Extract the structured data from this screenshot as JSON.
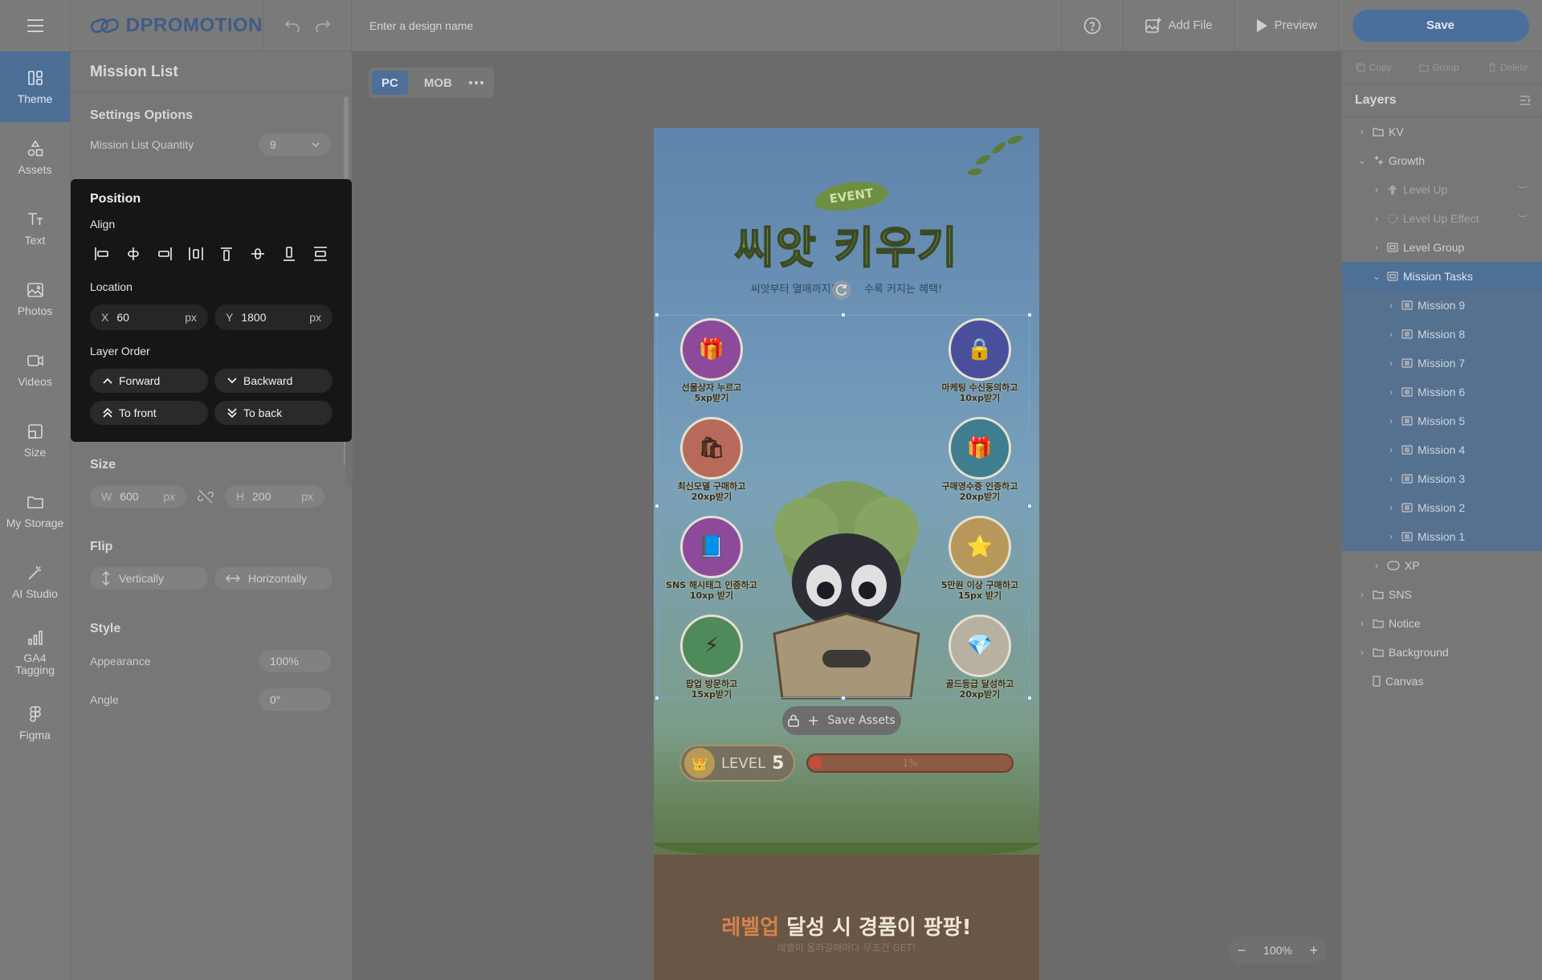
{
  "app": {
    "brand": "DPROMOTION"
  },
  "topbar": {
    "design_name_placeholder": "Enter a design name",
    "add_file_label": "Add File",
    "preview_label": "Preview",
    "save_label": "Save"
  },
  "rail": {
    "items": [
      {
        "label": "Theme",
        "icon": "theme-icon"
      },
      {
        "label": "Assets",
        "icon": "assets-icon"
      },
      {
        "label": "Text",
        "icon": "text-icon"
      },
      {
        "label": "Photos",
        "icon": "photos-icon"
      },
      {
        "label": "Videos",
        "icon": "videos-icon"
      },
      {
        "label": "Size",
        "icon": "size-icon"
      },
      {
        "label": "My Storage",
        "icon": "folder-icon"
      },
      {
        "label": "AI Studio",
        "icon": "magic-wand-icon"
      },
      {
        "label": "GA4 Tagging",
        "icon": "bar-chart-icon"
      },
      {
        "label": "Figma",
        "icon": "figma-icon"
      }
    ]
  },
  "panel": {
    "title": "Mission List",
    "settings_options_label": "Settings Options",
    "mission_list_quantity_label": "Mission List Quantity",
    "mission_list_quantity_value": "9",
    "size_label": "Size",
    "width_axis": "W",
    "width_value": "600",
    "height_axis": "H",
    "height_value": "200",
    "unit": "px",
    "flip_label": "Flip",
    "flip_vertical": "Vertically",
    "flip_horizontal": "Horizontally",
    "style_label": "Style",
    "appearance_label": "Appearance",
    "appearance_value": "100%",
    "angle_label": "Angle",
    "angle_value": "0°"
  },
  "position_popup": {
    "title": "Position",
    "align_label": "Align",
    "location_label": "Location",
    "x_axis": "X",
    "x_value": "60",
    "y_axis": "Y",
    "y_value": "1800",
    "unit": "px",
    "layer_order_label": "Layer Order",
    "forward": "Forward",
    "backward": "Backward",
    "to_front": "To front",
    "to_back": "To back"
  },
  "canvas": {
    "device_pc": "PC",
    "device_mob": "MOB",
    "zoom_value": "100%",
    "save_assets_label": "Save Assets"
  },
  "artboard": {
    "event_tag": "EVENT",
    "title": "씨앗 키우기",
    "subtitle_left": "씨앗부터 열매까지!",
    "subtitle_right": "수록 커지는 혜택!",
    "missions": [
      {
        "line1": "선물상자 누르고",
        "line2": "5xp받기",
        "color": "#8d4a9a",
        "icon": "🎁"
      },
      {
        "line1": "마케팅 수신동의하고",
        "line2": "10xp받기",
        "color": "#4a4f9c",
        "icon": "🔒"
      },
      {
        "line1": "최신모델 구매하고",
        "line2": "20xp받기",
        "color": "#b86a5a",
        "icon": "🛍"
      },
      {
        "line1": "구매영수증 인증하고",
        "line2": "20xp받기",
        "color": "#3f7e8e",
        "icon": "🎁"
      },
      {
        "line1": "SNS 해시태그 인증하고",
        "line2": "10xp 받기",
        "color": "#8d4a9a",
        "icon": "📘"
      },
      {
        "line1": "5만원 이상 구매하고",
        "line2": "15px 받기",
        "color": "#b8985a",
        "icon": "⭐"
      },
      {
        "line1": "팝업 방문하고",
        "line2": "15xp받기",
        "color": "#4f8a5a",
        "icon": "⚡"
      },
      {
        "line1": "골드등급 달성하고",
        "line2": "20xp받기",
        "color": "#b8b0a0",
        "icon": "💎"
      }
    ],
    "level_prefix": "LEVEL",
    "level_number": "5",
    "progress_percent": 1,
    "progress_label": "1%",
    "reward_highlight": "레벨업",
    "reward_rest": " 달성 시 경품이 팡팡!",
    "reward_sub": "레벨이 올라갈때마다 무조건 GET!"
  },
  "right_panel": {
    "copy": "Copy",
    "group": "Group",
    "delete": "Delete",
    "layers_title": "Layers",
    "layers": [
      {
        "label": "KV",
        "indent": 0,
        "state": "normal",
        "chev": "›",
        "icon": "folder"
      },
      {
        "label": "Growth",
        "indent": 0,
        "state": "normal",
        "chev": "⌄",
        "icon": "sparkle"
      },
      {
        "label": "Level Up",
        "indent": 1,
        "state": "dim",
        "chev": "›",
        "icon": "arrow-up"
      },
      {
        "label": "Level Up Effect",
        "indent": 1,
        "state": "dim",
        "chev": "›",
        "icon": "dashed"
      },
      {
        "label": "Level Group",
        "indent": 1,
        "state": "normal",
        "chev": "›",
        "icon": "frame"
      },
      {
        "label": "Mission Tasks",
        "indent": 1,
        "state": "selected",
        "chev": "⌄",
        "icon": "frame"
      },
      {
        "label": "Mission 9",
        "indent": 2,
        "state": "selchild",
        "chev": "›",
        "icon": "list"
      },
      {
        "label": "Mission 8",
        "indent": 2,
        "state": "selchild",
        "chev": "›",
        "icon": "list"
      },
      {
        "label": "Mission 7",
        "indent": 2,
        "state": "selchild",
        "chev": "›",
        "icon": "list"
      },
      {
        "label": "Mission 6",
        "indent": 2,
        "state": "selchild",
        "chev": "›",
        "icon": "list"
      },
      {
        "label": "Mission 5",
        "indent": 2,
        "state": "selchild",
        "chev": "›",
        "icon": "list"
      },
      {
        "label": "Mission 4",
        "indent": 2,
        "state": "selchild",
        "chev": "›",
        "icon": "list"
      },
      {
        "label": "Mission 3",
        "indent": 2,
        "state": "selchild",
        "chev": "›",
        "icon": "list"
      },
      {
        "label": "Mission 2",
        "indent": 2,
        "state": "selchild",
        "chev": "›",
        "icon": "list"
      },
      {
        "label": "Mission 1",
        "indent": 2,
        "state": "selchild",
        "chev": "›",
        "icon": "list"
      },
      {
        "label": "XP",
        "indent": 1,
        "state": "normal",
        "chev": "›",
        "icon": "xp"
      },
      {
        "label": "SNS",
        "indent": 0,
        "state": "normal",
        "chev": "›",
        "icon": "folder"
      },
      {
        "label": "Notice",
        "indent": 0,
        "state": "normal",
        "chev": "›",
        "icon": "folder"
      },
      {
        "label": "Background",
        "indent": 0,
        "state": "normal",
        "chev": "›",
        "icon": "folder"
      },
      {
        "label": "Canvas",
        "indent": 0,
        "state": "normal",
        "chev": "",
        "icon": "page"
      }
    ]
  },
  "colors": {
    "accent": "#4e6f96",
    "brand": "#3f5c86",
    "popup_bg": "#161616"
  }
}
